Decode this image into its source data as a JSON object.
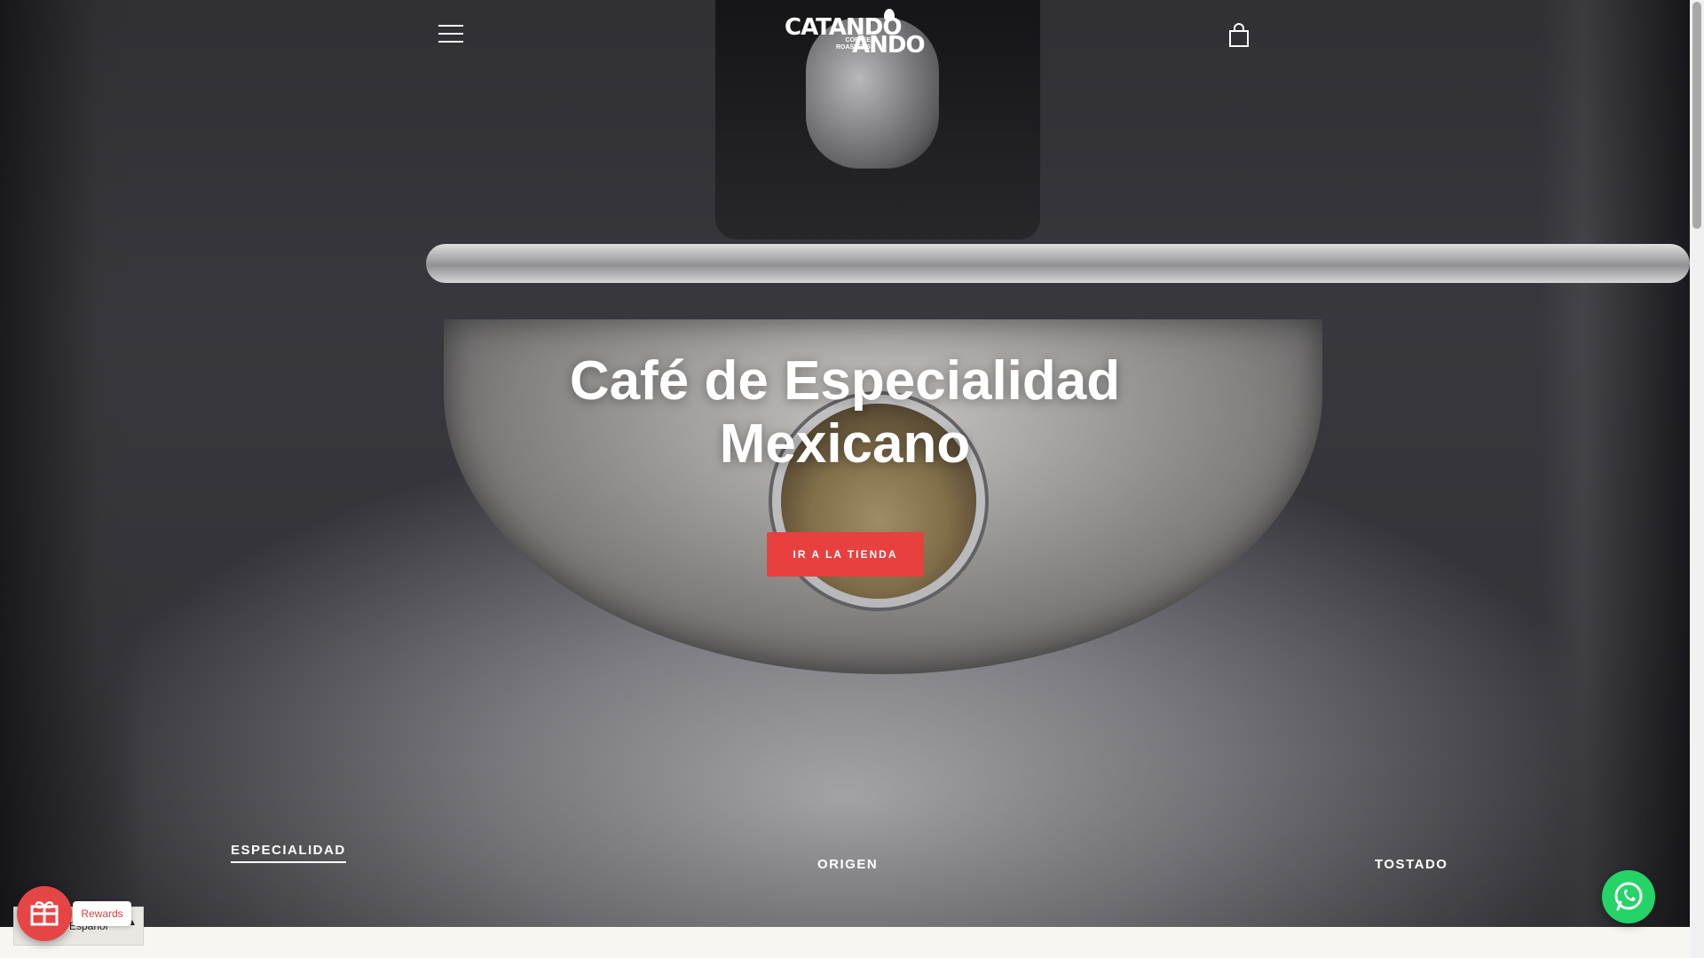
{
  "header": {
    "menu_icon": "hamburger-menu-icon",
    "logo": {
      "top": "CATANDO",
      "sub_line1": "COFFEE",
      "sub_line2": "ROASTERS",
      "bottom": "ANDO"
    },
    "cart_icon": "shopping-bag-icon"
  },
  "hero": {
    "title_line1": "Café de Especialidad",
    "title_line2": "Mexicano",
    "cta_label": "IR A LA TIENDA"
  },
  "tabs": [
    {
      "label": "ESPECIALIDAD",
      "active": true
    },
    {
      "label": "ORIGEN",
      "active": false
    },
    {
      "label": "TOSTADO",
      "active": false
    }
  ],
  "language": {
    "label": "Español"
  },
  "rewards": {
    "label": "Rewards",
    "icon": "gift-icon"
  },
  "whatsapp": {
    "icon": "whatsapp-icon"
  },
  "colors": {
    "cta": "#e8403f",
    "rewards": "#e64545",
    "whatsapp": "#25d366"
  }
}
